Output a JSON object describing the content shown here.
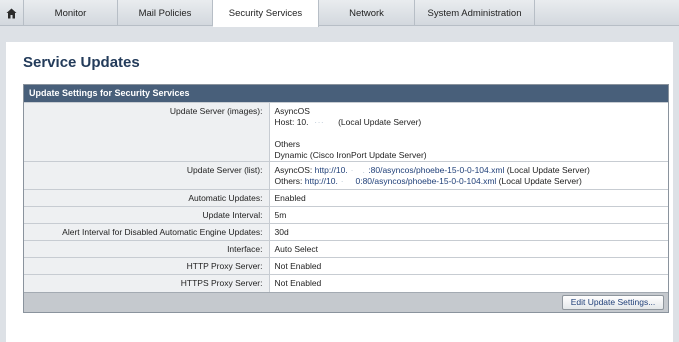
{
  "nav": {
    "home_icon": "home-icon",
    "tabs": [
      {
        "label": "Monitor"
      },
      {
        "label": "Mail Policies"
      },
      {
        "label": "Security Services"
      },
      {
        "label": "Network"
      },
      {
        "label": "System Administration"
      }
    ],
    "active_tab": "Security Services"
  },
  "page": {
    "title": "Service Updates"
  },
  "settings": {
    "header": "Update Settings for Security Services",
    "rows": [
      {
        "label": "Update Server (images):",
        "value_lines": [
          "AsyncOS",
          "Host: 10.",
          "(Local Update Server)",
          "Others",
          "Dynamic (Cisco IronPort Update Server)"
        ]
      },
      {
        "label": "Update Server (list):",
        "asyncos_prefix": "AsyncOS:",
        "asyncos_url_start": "http://10.",
        "asyncos_url_end": ":80/asyncos/phoebe-15-0-0-104.xml",
        "asyncos_suffix": "(Local Update Server)",
        "others_prefix": "Others:",
        "others_url_start": "http://10.",
        "others_url_end": "0:80/asyncos/phoebe-15-0-0-104.xml",
        "others_suffix": "(Local Update Server)"
      },
      {
        "label": "Automatic Updates:",
        "value": "Enabled"
      },
      {
        "label": "Update Interval:",
        "value": "5m"
      },
      {
        "label": "Alert Interval for Disabled Automatic Engine Updates:",
        "value": "30d"
      },
      {
        "label": "Interface:",
        "value": "Auto Select"
      },
      {
        "label": "HTTP Proxy Server:",
        "value": "Not Enabled"
      },
      {
        "label": "HTTPS Proxy Server:",
        "value": "Not Enabled"
      }
    ],
    "edit_button": "Edit Update Settings..."
  },
  "colors": {
    "header_bar": "#485f7a",
    "title": "#233b5a",
    "link": "#1f3f78"
  }
}
